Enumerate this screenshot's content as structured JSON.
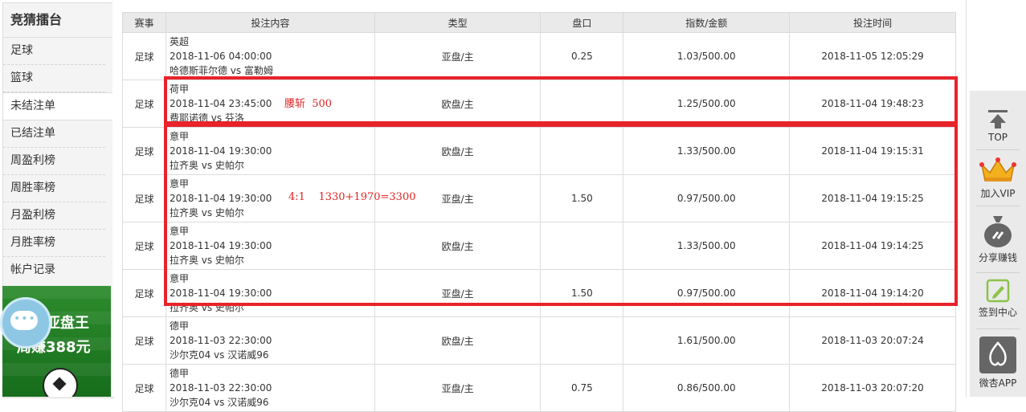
{
  "sidebar": {
    "title": "竞猜擂台",
    "items": [
      "足球",
      "篮球",
      "未结注单",
      "已结注单",
      "周盈利榜",
      "周胜率榜",
      "月盈利榜",
      "月胜率榜",
      "帐户记录"
    ],
    "active_index": 2
  },
  "banner": {
    "line1": "亚盘王",
    "line2": "周赚388元"
  },
  "table": {
    "headers": [
      "赛事",
      "投注内容",
      "类型",
      "盘口",
      "指数/金额",
      "投注时间"
    ],
    "rows": [
      {
        "sport": "足球",
        "league": "英超",
        "time": "2018-11-06 04:00:00",
        "match": "哈德斯菲尔德 vs 富勒姆",
        "type": "亚盘/主",
        "handicap": "0.25",
        "odds": "1.03/500.00",
        "bet_time": "2018-11-05 12:05:29"
      },
      {
        "sport": "足球",
        "league": "荷甲",
        "time": "2018-11-04 23:45:00",
        "match": "费耶诺德 vs 芬洛",
        "type": "欧盘/主",
        "handicap": "",
        "odds": "1.25/500.00",
        "bet_time": "2018-11-04 19:48:23"
      },
      {
        "sport": "足球",
        "league": "意甲",
        "time": "2018-11-04 19:30:00",
        "match": "拉齐奥 vs 史帕尔",
        "type": "欧盘/主",
        "handicap": "",
        "odds": "1.33/500.00",
        "bet_time": "2018-11-04 19:15:31"
      },
      {
        "sport": "足球",
        "league": "意甲",
        "time": "2018-11-04 19:30:00",
        "match": "拉齐奥 vs 史帕尔",
        "type": "亚盘/主",
        "handicap": "1.50",
        "odds": "0.97/500.00",
        "bet_time": "2018-11-04 19:15:25"
      },
      {
        "sport": "足球",
        "league": "意甲",
        "time": "2018-11-04 19:30:00",
        "match": "拉齐奥 vs 史帕尔",
        "type": "欧盘/主",
        "handicap": "",
        "odds": "1.33/500.00",
        "bet_time": "2018-11-04 19:14:25"
      },
      {
        "sport": "足球",
        "league": "意甲",
        "time": "2018-11-04 19:30:00",
        "match": "拉齐奥 vs 史帕尔",
        "type": "亚盘/主",
        "handicap": "1.50",
        "odds": "0.97/500.00",
        "bet_time": "2018-11-04 19:14:20"
      },
      {
        "sport": "足球",
        "league": "德甲",
        "time": "2018-11-03 22:30:00",
        "match": "沙尔克04 vs 汉诺威96",
        "type": "欧盘/主",
        "handicap": "",
        "odds": "1.61/500.00",
        "bet_time": "2018-11-03 20:07:24"
      },
      {
        "sport": "足球",
        "league": "德甲",
        "time": "2018-11-03 22:30:00",
        "match": "沙尔克04 vs 汉诺威96",
        "type": "亚盘/主",
        "handicap": "0.75",
        "odds": "0.86/500.00",
        "bet_time": "2018-11-03 20:07:20"
      }
    ]
  },
  "annotations": {
    "note1": "腰斩  500",
    "note2": "4:1    1330+1970=3300",
    "color": "#e8232a"
  },
  "tools": [
    {
      "label": "TOP",
      "icon": "arrow-up-icon"
    },
    {
      "label": "加入VIP",
      "icon": "crown-icon"
    },
    {
      "label": "分享赚钱",
      "icon": "money-bag-icon"
    },
    {
      "label": "签到中心",
      "icon": "pencil-icon"
    },
    {
      "label": "微杏APP",
      "icon": "app-logo-icon"
    }
  ]
}
